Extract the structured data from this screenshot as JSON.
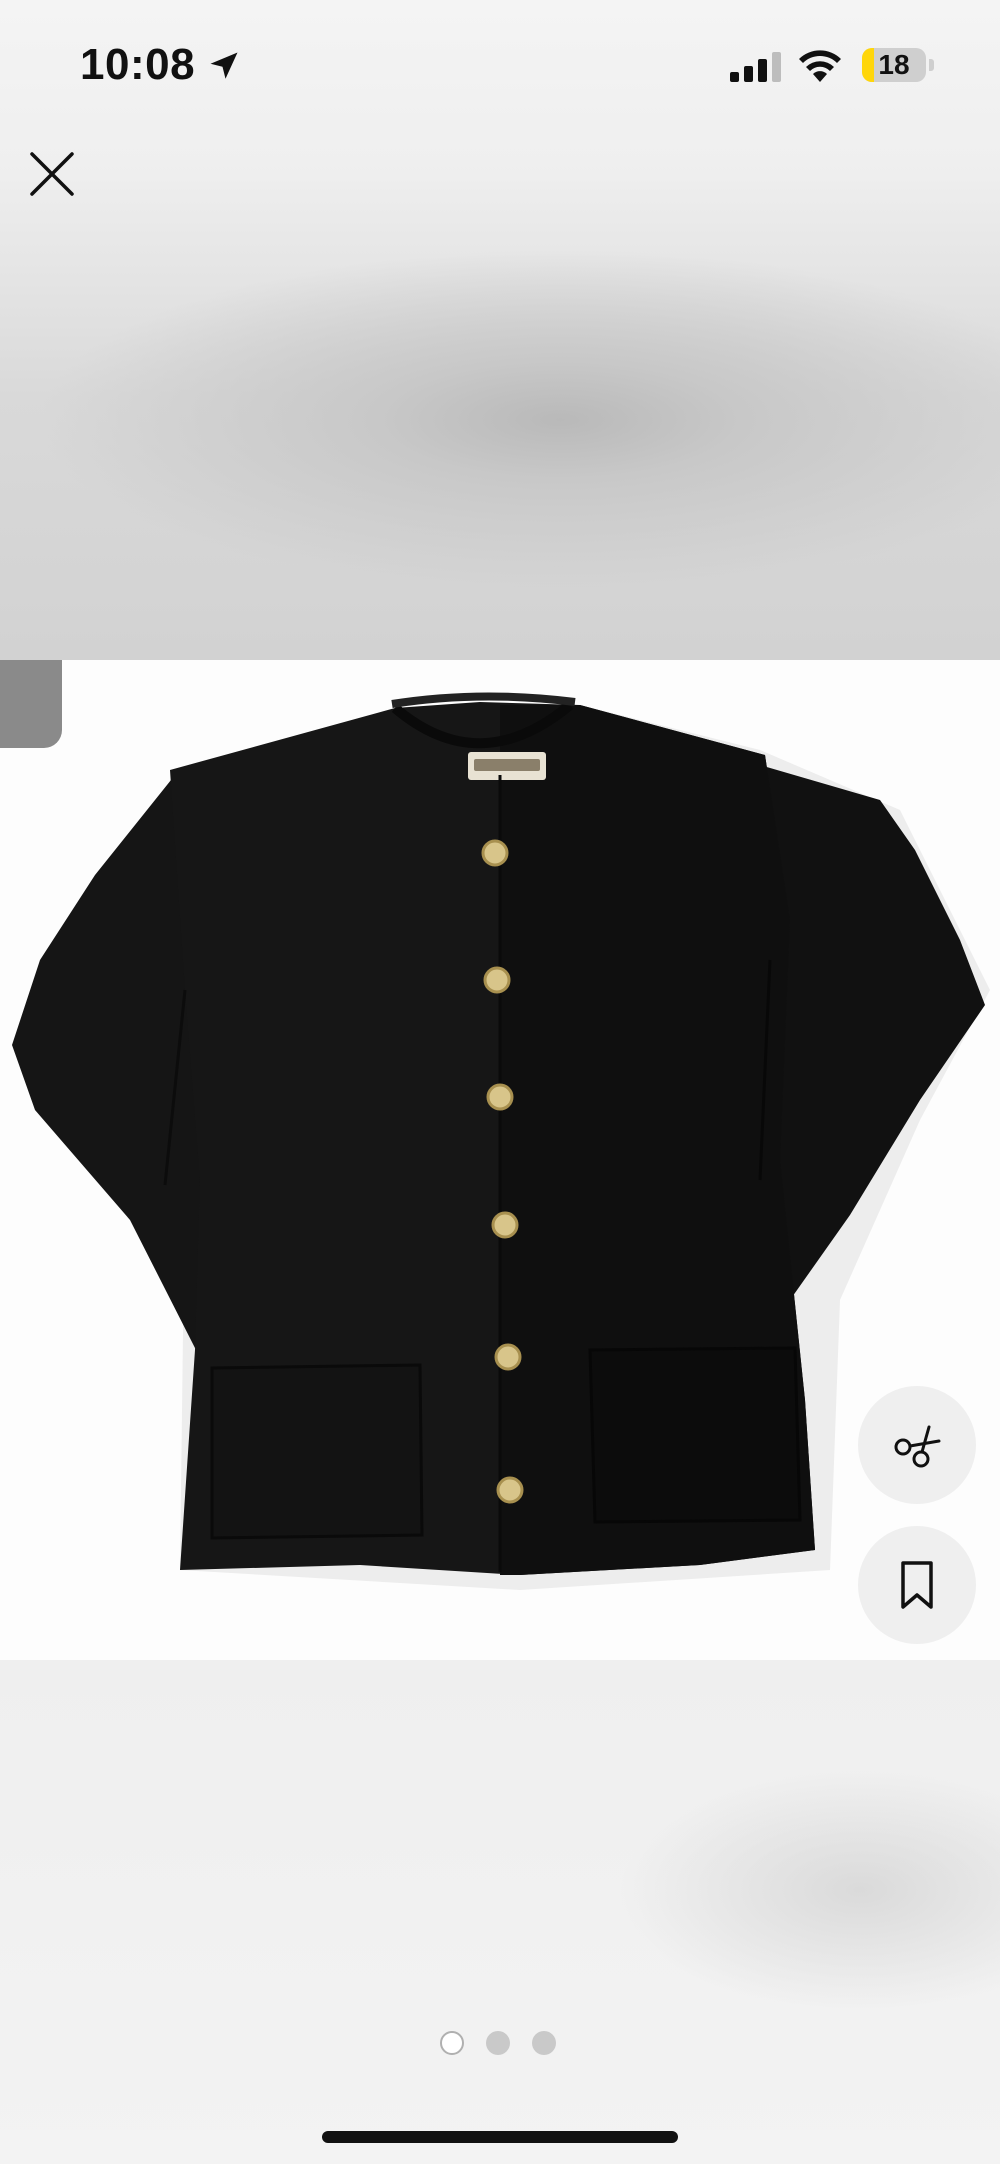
{
  "status_bar": {
    "time": "10:08",
    "battery_level": "18",
    "battery_fraction": 0.18,
    "icons": [
      "location-arrow-icon",
      "cellular-signal-icon",
      "wifi-icon",
      "battery-icon"
    ]
  },
  "toolbar": {
    "close_icon": "close-icon"
  },
  "photo": {
    "subject": "black-knit-cardigan-with-gold-buttons",
    "background_color": "#fdfdfd",
    "garment_color": "#141414",
    "button_color": "#d8c58a"
  },
  "actions": {
    "find_similar_icon": "scissors-icon",
    "save_icon": "bookmark-icon"
  },
  "pagination": {
    "page_count": 3,
    "current_page": 1
  },
  "colors": {
    "battery_accent": "#ffd60a",
    "text": "#111111"
  }
}
